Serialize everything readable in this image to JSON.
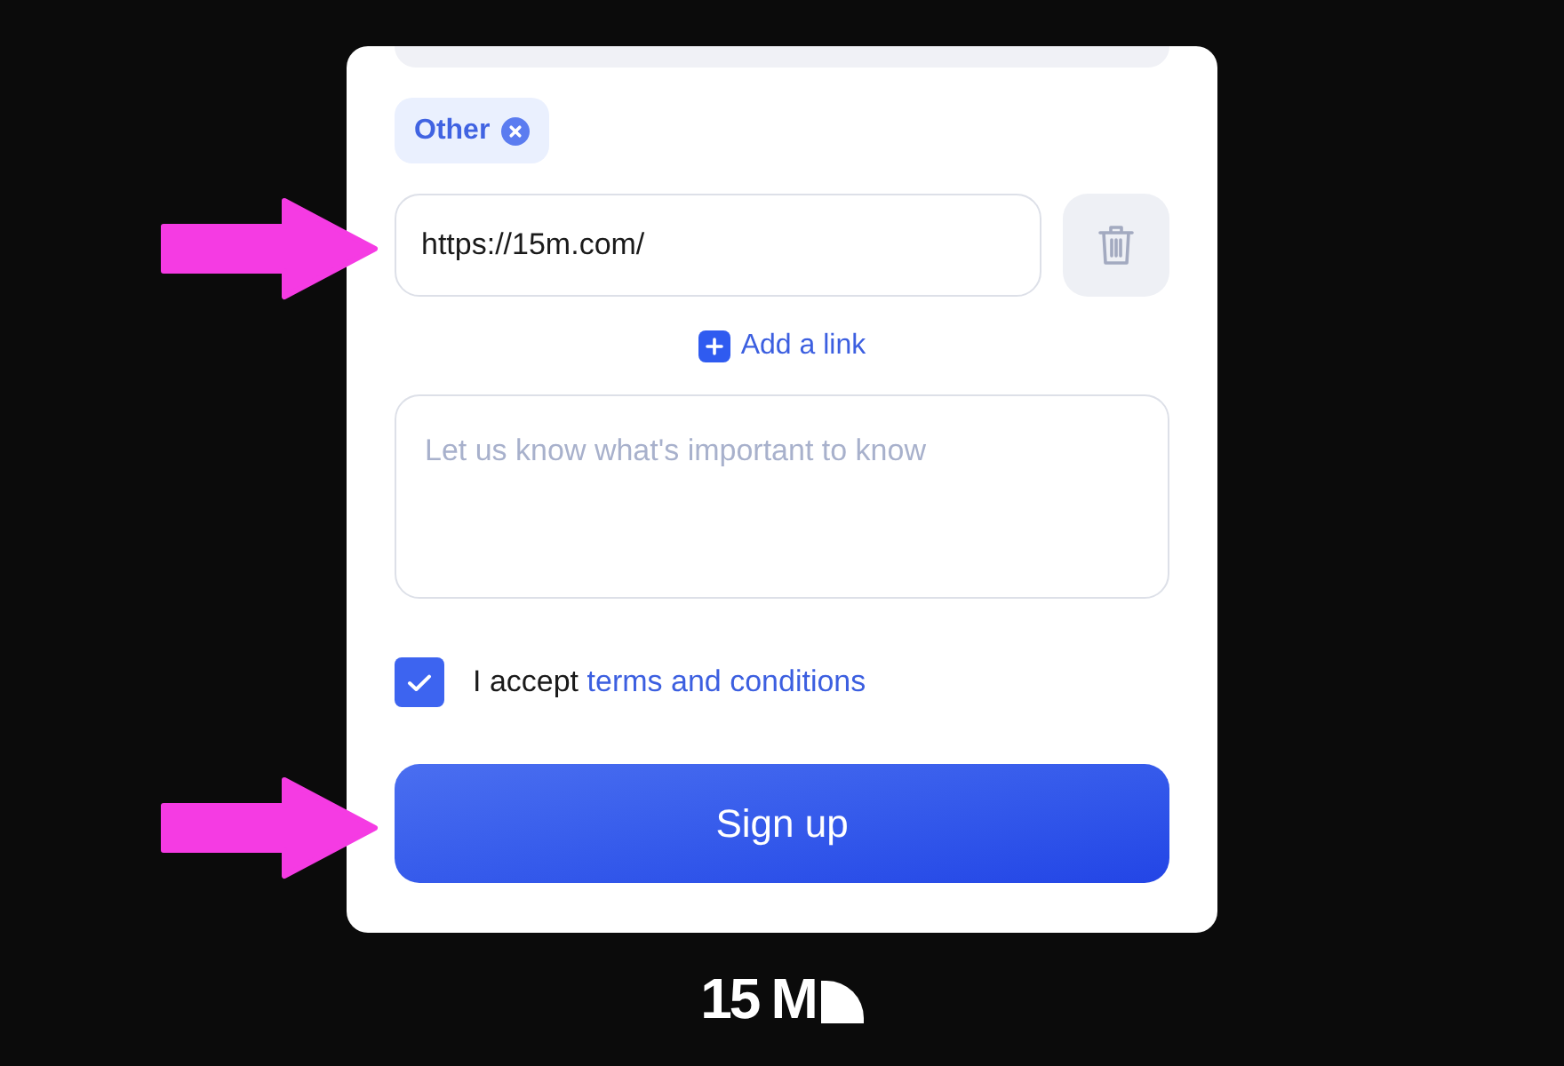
{
  "tags": [
    {
      "label": "Other"
    }
  ],
  "link_field": {
    "value": "https://15m.com/"
  },
  "add_link": {
    "label": "Add a link"
  },
  "notes": {
    "placeholder": "Let us know what's important to know"
  },
  "terms": {
    "checked": true,
    "text": "I accept",
    "link": "terms and conditions"
  },
  "submit": {
    "label": "Sign up"
  },
  "logo": {
    "text": "15 M"
  }
}
